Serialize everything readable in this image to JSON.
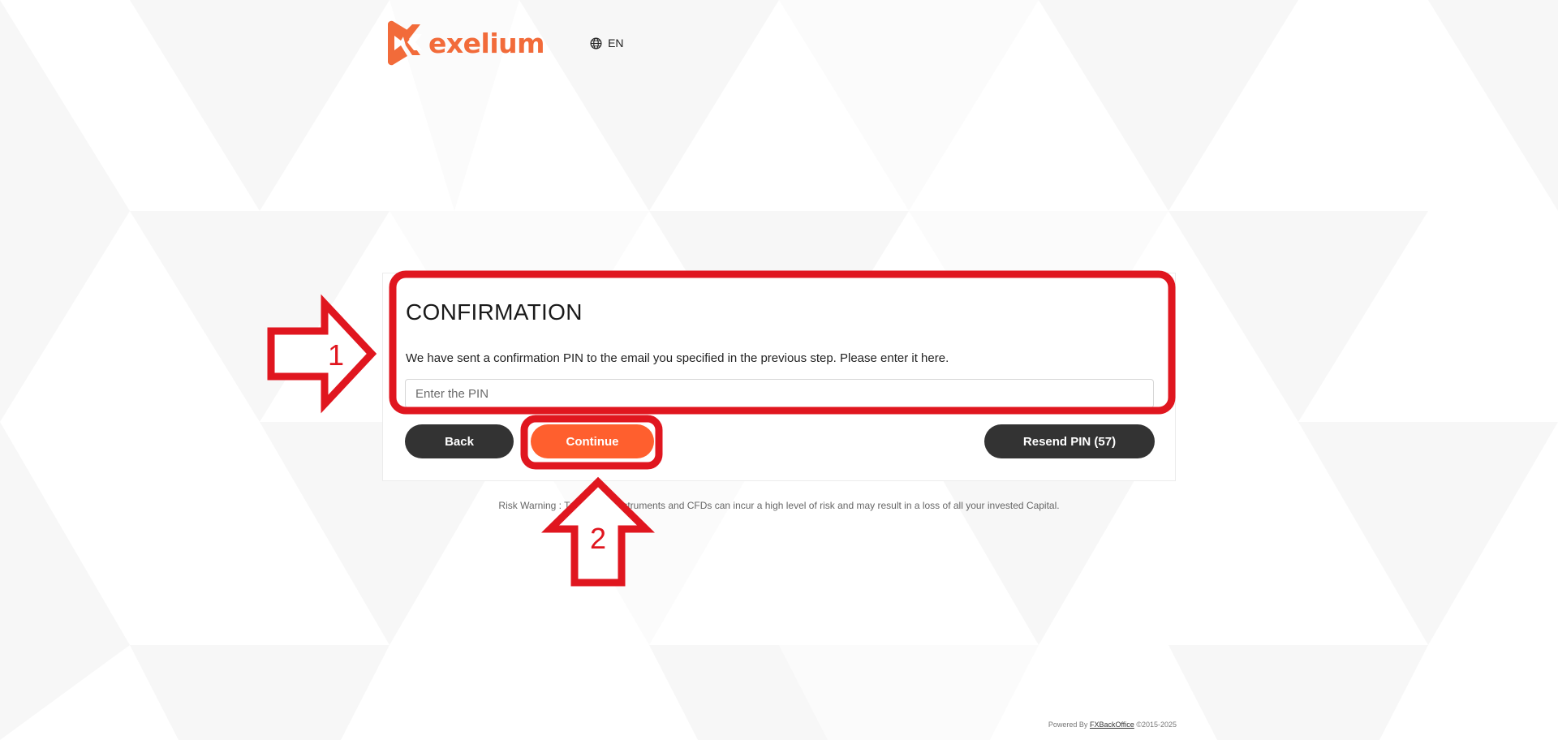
{
  "brand": {
    "name": "exelium",
    "color": "#f26b3a"
  },
  "language": {
    "code": "EN",
    "icon": "globe-icon"
  },
  "confirmation": {
    "title": "CONFIRMATION",
    "message": "We have sent a confirmation PIN to the email you specified in the previous step. Please enter it here.",
    "pin_placeholder": "Enter the PIN",
    "pin_value": "",
    "back_label": "Back",
    "continue_label": "Continue",
    "resend_label": "Resend PIN (57)"
  },
  "risk_warning": "Risk Warning : Trading FX Instruments and CFDs can incur a high level of risk and may result in a loss of all your invested Capital.",
  "footer": {
    "powered_by": "Powered By",
    "link_text": "FXBackOffice",
    "copyright": "©2015-2025"
  },
  "annotations": {
    "step1": "1",
    "step2": "2",
    "color": "#e0161f"
  },
  "colors": {
    "primary_button": "#ff5f2e",
    "dark_button": "#333333"
  }
}
